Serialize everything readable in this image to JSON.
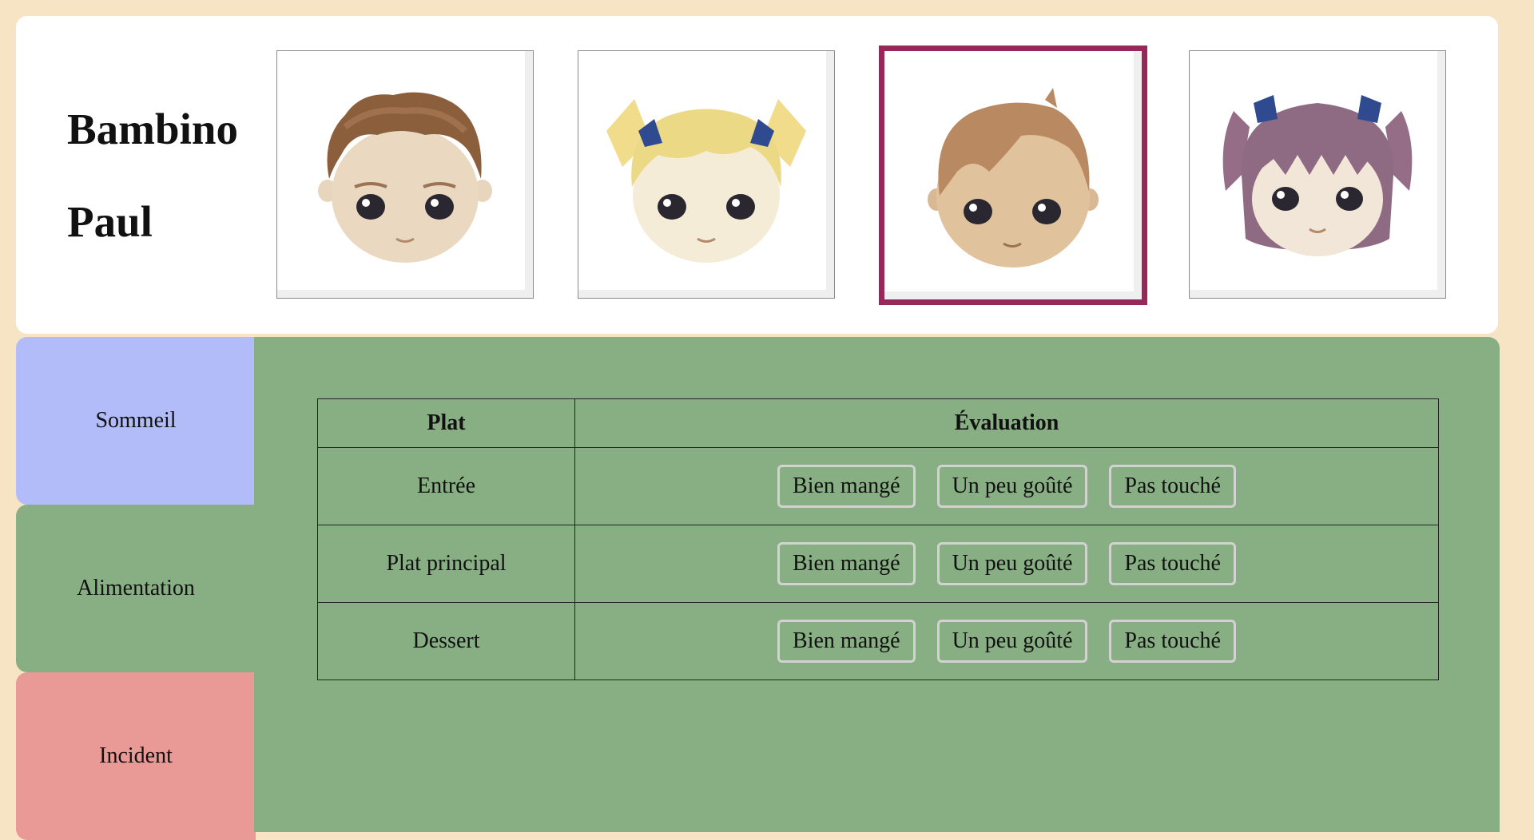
{
  "header": {
    "title_line1": "Bambino",
    "title_line2": "Paul",
    "avatars": [
      {
        "name": "boy-brown-curly",
        "selected": false
      },
      {
        "name": "girl-blonde-pigtails",
        "selected": false
      },
      {
        "name": "boy-light-brown",
        "selected": true
      },
      {
        "name": "girl-purple-pigtails",
        "selected": false
      }
    ]
  },
  "tabs": [
    {
      "label": "Sommeil",
      "color": "#b1bcf9"
    },
    {
      "label": "Alimentation",
      "color": "#88af83"
    },
    {
      "label": "Incident",
      "color": "#e99a97"
    }
  ],
  "colors": {
    "page_bg": "#f6e4c5",
    "panel_bg": "#88af83",
    "selected_border": "#96285a"
  },
  "table": {
    "headers": [
      "Plat",
      "Évaluation"
    ],
    "rows": [
      {
        "dish": "Entrée",
        "options": [
          "Bien mangé",
          "Un peu goûté",
          "Pas touché"
        ]
      },
      {
        "dish": "Plat principal",
        "options": [
          "Bien mangé",
          "Un peu goûté",
          "Pas touché"
        ]
      },
      {
        "dish": "Dessert",
        "options": [
          "Bien mangé",
          "Un peu goûté",
          "Pas touché"
        ]
      }
    ]
  }
}
